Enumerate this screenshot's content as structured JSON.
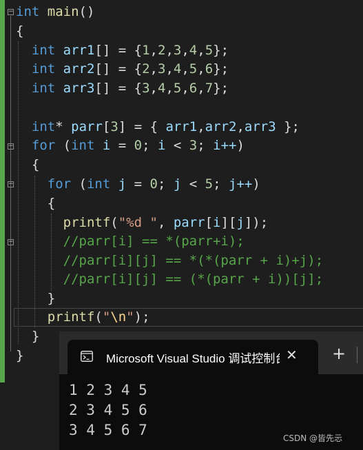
{
  "editor": {
    "lines": {
      "main_sig": {
        "type": "int",
        "name": "main",
        "parens": "()"
      },
      "open_brace_main": "{",
      "arr1": {
        "type": "int",
        "name": "arr1",
        "decl": "[] = {",
        "values": [
          "1",
          "2",
          "3",
          "4",
          "5"
        ],
        "close": "};"
      },
      "arr2": {
        "type": "int",
        "name": "arr2",
        "decl": "[] = {",
        "values": [
          "2",
          "3",
          "4",
          "5",
          "6"
        ],
        "close": "};"
      },
      "arr3": {
        "type": "int",
        "name": "arr3",
        "decl": "[] = {",
        "values": [
          "3",
          "4",
          "5",
          "6",
          "7"
        ],
        "close": "};"
      },
      "parr": {
        "type": "int",
        "star": "*",
        "name": "parr",
        "size": "3",
        "rest1": " = { ",
        "a1": "arr1",
        "a2": "arr2",
        "a3": "arr3",
        "rest2": " };"
      },
      "for_i": {
        "kw": "for",
        "type": "int",
        "var": "i",
        "init": "0",
        "limit": "3",
        "inc": "i++"
      },
      "open_brace_for_i": "{",
      "for_j": {
        "kw": "for",
        "type": "int",
        "var": "j",
        "init": "0",
        "limit": "5",
        "inc": "j++"
      },
      "open_brace_for_j": "{",
      "printf1": {
        "fn": "printf",
        "fmt": "\"%d \"",
        "arg": "parr",
        "i": "i",
        "j": "j"
      },
      "comment1": "//parr[i] == *(parr+i);",
      "comment2": "//parr[i][j] == *(*(parr + i)+j);",
      "comment3": "//parr[i][j] == (*(parr + i))[j];",
      "close_brace_for_j": "}",
      "printf2": {
        "fn": "printf",
        "q1": "\"",
        "esc": "\\n",
        "q2": "\"",
        "close": ");"
      },
      "close_brace_for_i": "}",
      "close_brace_main": "}"
    }
  },
  "console": {
    "tab_title": "Microsoft Visual Studio 调试控制台",
    "icon": "terminal-icon",
    "close_glyph": "✕",
    "add_glyph": "+",
    "output_lines": [
      "1 2 3 4 5",
      "2 3 4 5 6",
      "3 4 5 6 7"
    ]
  },
  "watermark": "CSDN @皆先忈",
  "colors": {
    "background": "#1e1e1e",
    "keyword": "#569cd6",
    "function": "#dcdcaa",
    "variable": "#9cdcfe",
    "number": "#b5cea8",
    "string": "#d69d85",
    "comment": "#57a64a",
    "console_bg": "#0c0c0c"
  }
}
